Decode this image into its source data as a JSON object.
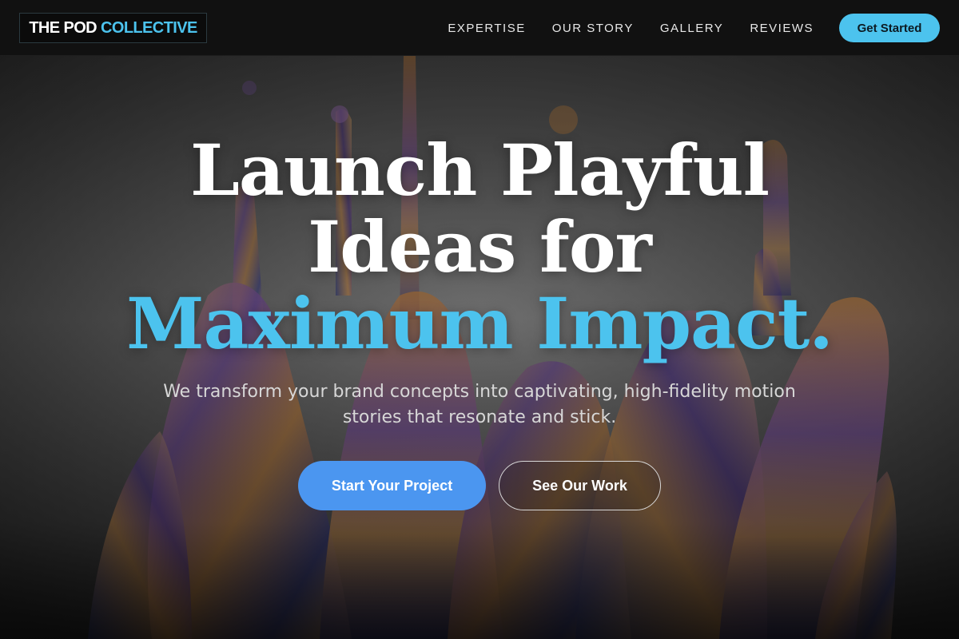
{
  "brand": {
    "part1": "THE POD",
    "part2": "COLLECTIVE"
  },
  "nav": {
    "links": [
      "EXPERTISE",
      "OUR STORY",
      "GALLERY",
      "REVIEWS"
    ],
    "cta": "Get Started"
  },
  "hero": {
    "headline_line1": "Launch Playful",
    "headline_line2": "Ideas for",
    "headline_accent": "Maximum Impact.",
    "subtitle": "We transform your brand concepts into captivating, high-fidelity motion stories that resonate and stick.",
    "primary_button": "Start Your Project",
    "secondary_button": "See Our Work"
  },
  "colors": {
    "accent": "#4cc3ee",
    "primary_button": "#4b96f0",
    "nav_background": "#111111"
  }
}
